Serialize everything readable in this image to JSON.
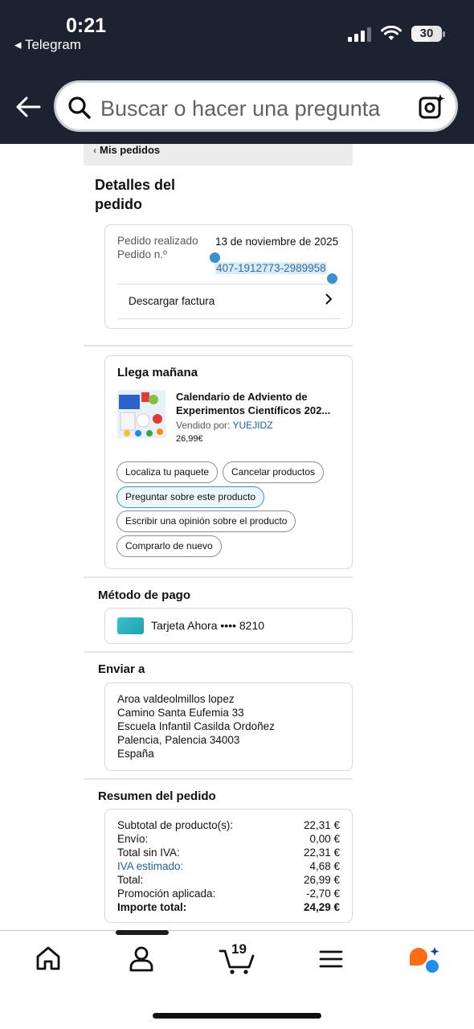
{
  "status_bar": {
    "time": "0:21",
    "back_app": "◂ Telegram",
    "battery": "30"
  },
  "search": {
    "placeholder": "Buscar o hacer una pregunta"
  },
  "breadcrumb": "Mis pedidos",
  "page_title_line1": "Detalles del",
  "page_title_line2": "pedido",
  "order": {
    "placed_label": "Pedido realizado",
    "number_label": "Pedido n.º",
    "date": "13 de noviembre de 2025",
    "number": "407-1912773-2989958",
    "invoice_label": "Descargar factura"
  },
  "delivery": {
    "title": "Llega mañana",
    "product_title_line1": "Calendario de Adviento de",
    "product_title_line2": "Experimentos Científicos 202...",
    "seller_label": "Vendido por:",
    "seller": "YUEJIDZ",
    "price": "26,99€",
    "actions": {
      "track": "Localiza tu paquete",
      "cancel": "Cancelar productos",
      "ask": "Preguntar sobre este producto",
      "review": "Escribir una opinión sobre el producto",
      "rebuy": "Comprarlo de nuevo"
    }
  },
  "payment": {
    "title": "Método de pago",
    "method": "Tarjeta Ahora •••• 8210",
    "card_color": "#2fb3bf"
  },
  "shipping": {
    "title": "Enviar a",
    "lines": [
      "Aroa valdeolmillos lopez",
      "Camino Santa Eufemia 33",
      "Escuela Infantil Casilda Ordoñez",
      "Palencia, Palencia 34003",
      "España"
    ]
  },
  "summary": {
    "title": "Resumen del pedido",
    "rows": [
      {
        "label": "Subtotal de producto(s):",
        "value": "22,31 €"
      },
      {
        "label": "Envío:",
        "value": "0,00 €"
      },
      {
        "label": "Total sin IVA:",
        "value": "22,31 €"
      },
      {
        "label": "IVA estimado:",
        "value": "4,68 €"
      },
      {
        "label": "Total:",
        "value": "26,99 €"
      },
      {
        "label": "Promoción aplicada:",
        "value": "-2,70 €"
      },
      {
        "label": "Importe total:",
        "value": "24,29 €"
      }
    ]
  },
  "bottom_nav": {
    "cart_count": "19",
    "icons": [
      "home-icon",
      "account-icon",
      "cart-icon",
      "menu-icon",
      "rufus-icon"
    ]
  },
  "colors": {
    "header_bg": "#1b2330",
    "link": "#2162a1",
    "selection": "#3d8fcf"
  }
}
